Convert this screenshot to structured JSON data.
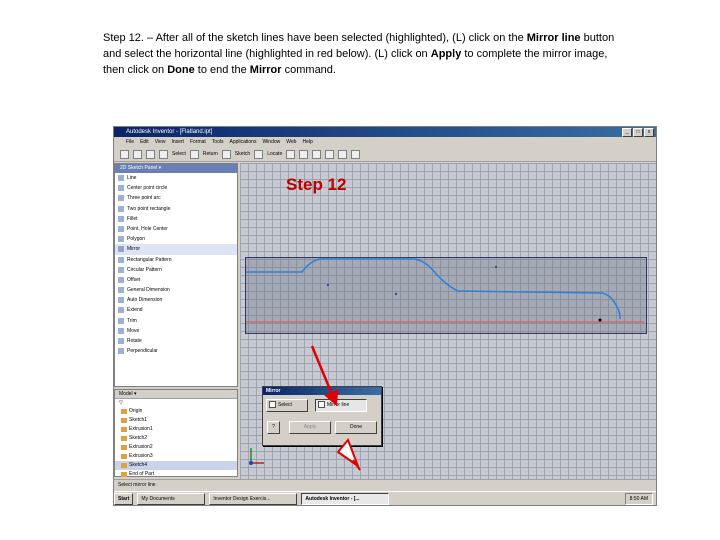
{
  "instructions": {
    "line1_prefix": "Step 12. – After all of the sketch lines have been selected (highlighted), (L) click on the",
    "line1_mirror": "Mirror line",
    "line1_suffix": "button",
    "line2_prefix": "and select the horizontal line (highlighted in red below). (L) click on",
    "line2_apply": "Apply",
    "line2_suffix": "to complete the mirror image,",
    "line3_prefix": "then click on",
    "line3_done": "Done",
    "line3_mid": "to end the",
    "line3_mirror": "Mirror",
    "line3_suffix": "command."
  },
  "app": {
    "title": "Autodesk Inventor - [Flatland.ipt]",
    "window_buttons": [
      "_",
      "□",
      "x"
    ],
    "menu": [
      "File",
      "Edit",
      "View",
      "Insert",
      "Format",
      "Tools",
      "Applications",
      "Window",
      "Web",
      "Help"
    ],
    "toolbar": {
      "select": "Select",
      "return": "Return",
      "sketch": "Sketch",
      "locate": "Locate"
    }
  },
  "sketch_panel": {
    "title": "2D Sketch Panel ▾",
    "items": [
      "Line",
      "Center point circle",
      "Three point arc",
      "Two point rectangle",
      "Fillet",
      "Point, Hole Center",
      "Polygon",
      "Mirror",
      "Rectangular Pattern",
      "Circular Pattern",
      "Offset",
      "General Dimension",
      "Auto Dimension",
      "Extend",
      "Trim",
      "Move",
      "Rotate",
      "Perpendicular"
    ]
  },
  "model_browser": {
    "title": "Model ▾",
    "tree": [
      "Origin",
      "Sketch1",
      "Extrusion1",
      "Sketch2",
      "Extrusion2",
      "Extrusion3",
      "Sketch4",
      "End of Part"
    ]
  },
  "canvas": {
    "step_label": "Step 12"
  },
  "mirror_dialog": {
    "title": "Mirror",
    "select_label": "Select",
    "mirror_line_label": "Mirror line",
    "apply_label": "Apply",
    "done_label": "Done"
  },
  "status": {
    "text": "Select mirror line"
  },
  "taskbar": {
    "start": "Start",
    "items": [
      "My Documents",
      "Inventor Design Exercis...",
      "Autodesk Inventor - [..."
    ],
    "clock": "8:50 AM"
  },
  "colors": {
    "arrow": "#e00000",
    "curve": "#2f7fd6",
    "mirror_line": "#e05050"
  }
}
